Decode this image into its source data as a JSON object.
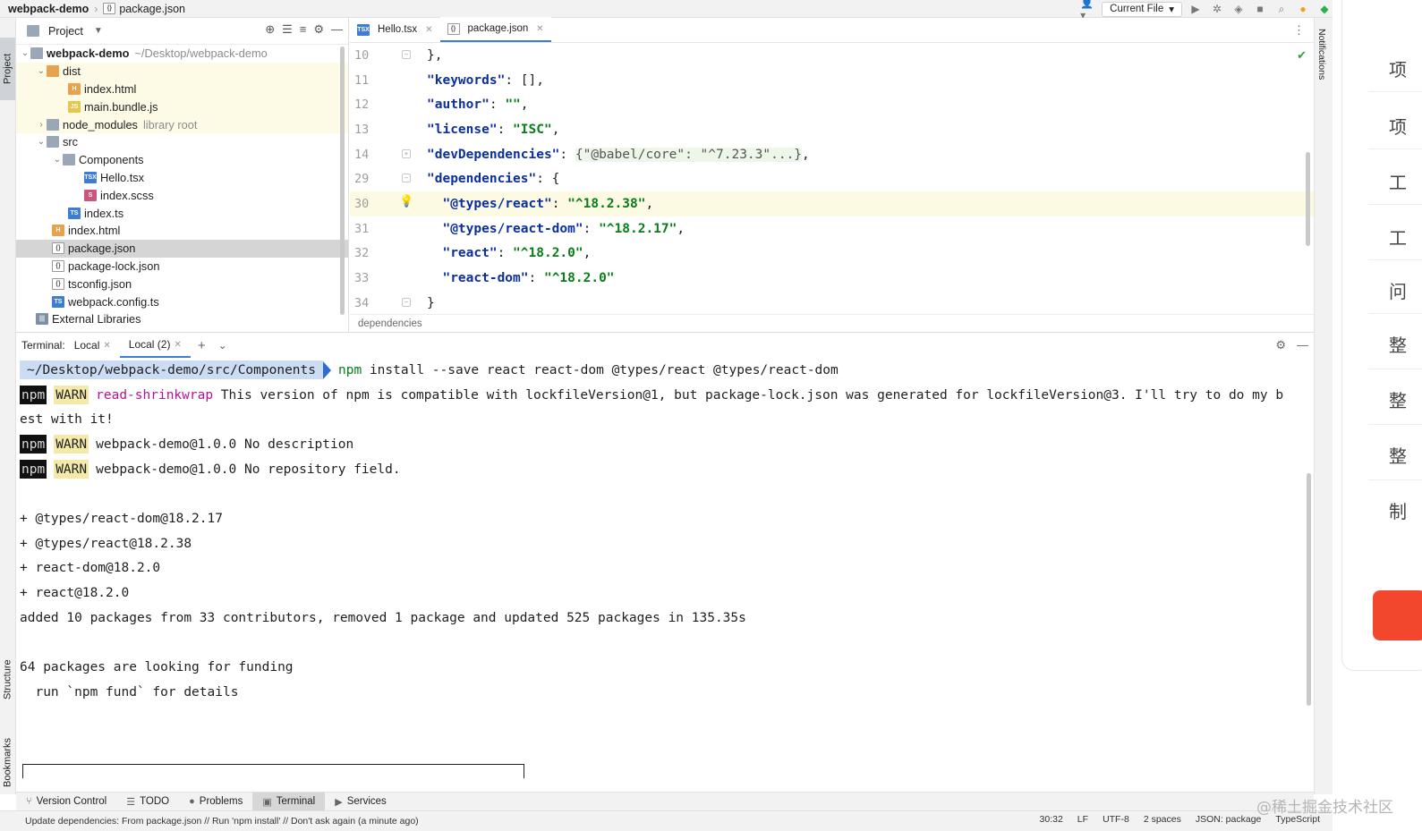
{
  "navbar": {
    "project": "webpack-demo",
    "file": "package.json",
    "run_config": "Current File"
  },
  "left_stripe": {
    "project": "Project",
    "structure": "Structure",
    "bookmarks": "Bookmarks"
  },
  "project_panel": {
    "title": "Project",
    "tree": [
      {
        "label": "webpack-demo",
        "hint": "~/Desktop/webpack-demo",
        "bold": true
      },
      {
        "label": "dist"
      },
      {
        "label": "index.html"
      },
      {
        "label": "main.bundle.js"
      },
      {
        "label": "node_modules",
        "hint": "library root"
      },
      {
        "label": "src"
      },
      {
        "label": "Components"
      },
      {
        "label": "Hello.tsx"
      },
      {
        "label": "index.scss"
      },
      {
        "label": "index.ts"
      },
      {
        "label": "index.html"
      },
      {
        "label": "package.json"
      },
      {
        "label": "package-lock.json"
      },
      {
        "label": "tsconfig.json"
      },
      {
        "label": "webpack.config.ts"
      },
      {
        "label": "External Libraries"
      }
    ]
  },
  "editor": {
    "tabs": [
      {
        "label": "Hello.tsx"
      },
      {
        "label": "package.json"
      }
    ],
    "lines": [
      {
        "num": "10"
      },
      {
        "num": "11"
      },
      {
        "num": "12"
      },
      {
        "num": "13"
      },
      {
        "num": "14"
      },
      {
        "num": "29"
      },
      {
        "num": "30"
      },
      {
        "num": "31"
      },
      {
        "num": "32"
      },
      {
        "num": "33"
      },
      {
        "num": "34"
      }
    ],
    "tokens": {
      "l10": "},",
      "l11_key": "\"keywords\"",
      "l11_rest": ": [],",
      "l12_key": "\"author\"",
      "l12_sep": ": ",
      "l12_val": "\"\"",
      "l12_end": ",",
      "l13_key": "\"license\"",
      "l13_sep": ": ",
      "l13_val": "\"ISC\"",
      "l13_end": ",",
      "l14_key": "\"devDependencies\"",
      "l14_sep": ": ",
      "l14_fold": "{\"@babel/core\": \"^7.23.3\"...}",
      "l14_end": ",",
      "l29_key": "\"dependencies\"",
      "l29_rest": ": {",
      "l30_key": "\"@types/react\"",
      "l30_sep": ": ",
      "l30_val": "\"^18.2.38\"",
      "l30_end": ",",
      "l31_key": "\"@types/react-dom\"",
      "l31_sep": ": ",
      "l31_val": "\"^18.2.17\"",
      "l31_end": ",",
      "l32_key": "\"react\"",
      "l32_sep": ": ",
      "l32_val": "\"^18.2.0\"",
      "l32_end": ",",
      "l33_key": "\"react-dom\"",
      "l33_sep": ": ",
      "l33_val": "\"^18.2.0\"",
      "l34": "}"
    },
    "breadcrumb": "dependencies"
  },
  "right_stripe": {
    "notifications": "Notifications"
  },
  "terminal": {
    "label": "Terminal:",
    "tabs": [
      {
        "label": "Local"
      },
      {
        "label": "Local (2)"
      }
    ],
    "prompt_path": "~/Desktop/webpack-demo/src/Components",
    "cmd_npm": "npm",
    "cmd_args": " install --save react react-dom @types/react @types/react-dom",
    "npm_badge": "npm",
    "warn_badge": "WARN",
    "warn1_tag": "read-shrinkwrap",
    "warn1_text": " This version of npm is compatible with lockfileVersion@1, but package-lock.json was generated for lockfileVersion@3. I'll try to do my b",
    "warn1_cont": "est with it!",
    "warn2_text": "webpack-demo@1.0.0 No description",
    "warn3_text": "webpack-demo@1.0.0 No repository field.",
    "output": [
      "",
      "+ @types/react-dom@18.2.17",
      "+ @types/react@18.2.38",
      "+ react-dom@18.2.0",
      "+ react@18.2.0",
      "added 10 packages from 33 contributors, removed 1 package and updated 525 packages in 135.35s",
      "",
      "64 packages are looking for funding",
      "  run `npm fund` for details"
    ]
  },
  "toolbar": {
    "version_control": "Version Control",
    "todo": "TODO",
    "problems": "Problems",
    "terminal": "Terminal",
    "services": "Services"
  },
  "statusbar": {
    "message": "Update dependencies: From package.json // Run 'npm install' // Don't ask again (a minute ago)",
    "position": "30:32",
    "line_sep": "LF",
    "encoding": "UTF-8",
    "indent": "2 spaces",
    "schema": "JSON: package",
    "lang": "TypeScript"
  },
  "side_panel": {
    "items": [
      "项",
      "项",
      "工",
      "工",
      "问",
      "整",
      "整",
      "整",
      "制"
    ]
  },
  "watermark": "@稀土掘金技术社区",
  "colors": {
    "accent": "#3d7dd6",
    "string": "#067d17",
    "key": "#0b2f9e",
    "magenta": "#b3129a"
  }
}
